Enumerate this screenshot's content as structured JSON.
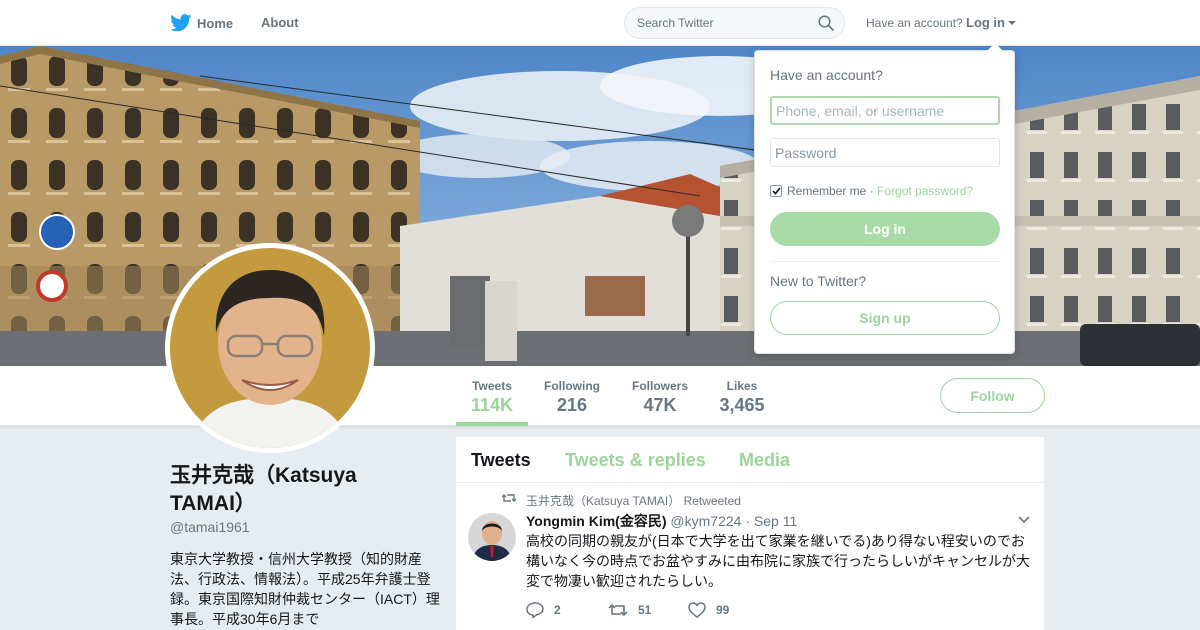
{
  "nav": {
    "home_label": "Home",
    "about_label": "About",
    "search_placeholder": "Search Twitter",
    "have_account_text": "Have an account?",
    "login_label": "Log in"
  },
  "profile": {
    "name": "玉井克哉（Katsuya TAMAI）",
    "handle": "@tamai1961",
    "bio": "東京大学教授・信州大学教授（知的財産法、行政法、情報法）。平成25年弁護士登録。東京国際知財仲裁センター（IACT）理事長。平成30年6月まで"
  },
  "stats": [
    {
      "label": "Tweets",
      "value": "114K"
    },
    {
      "label": "Following",
      "value": "216"
    },
    {
      "label": "Followers",
      "value": "47K"
    },
    {
      "label": "Likes",
      "value": "3,465"
    }
  ],
  "follow_label": "Follow",
  "timeline": {
    "tabs": [
      "Tweets",
      "Tweets & replies",
      "Media"
    ],
    "tweet": {
      "retweeted_by": "玉井克哉（Katsuya TAMAI） Retweeted",
      "author": "Yongmin Kim(金容民)",
      "handle": "@kym7224",
      "separator": "·",
      "date": "Sep 11",
      "text": "高校の同期の親友が(日本で大学を出て家業を継いでる)あり得ない程安いのでお構いなく今の時点でお盆やすみに由布院に家族で行ったらしいがキャンセルが大変で物凄い歓迎されたらしい。",
      "replies": "2",
      "retweets": "51",
      "likes": "99"
    }
  },
  "login_dropdown": {
    "title": "Have an account?",
    "username_placeholder": "Phone, email, or username",
    "password_placeholder": "Password",
    "remember_label": "Remember me",
    "separator": "·",
    "forgot_label": "Forgot password?",
    "login_button": "Log in",
    "new_text": "New to Twitter?",
    "signup_button": "Sign up"
  },
  "colors": {
    "accent": "#9ad59a",
    "text_secondary": "#657786",
    "twitter_blue": "#1da1f2"
  }
}
